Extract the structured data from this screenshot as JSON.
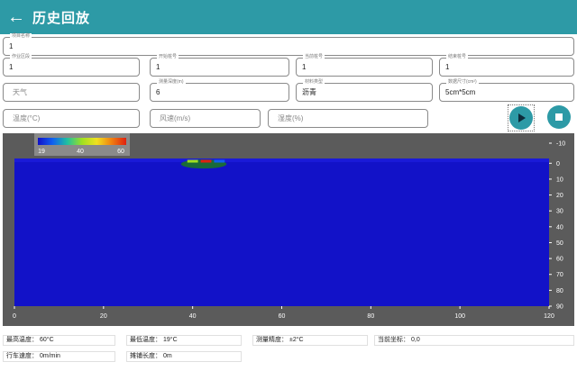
{
  "header": {
    "back_icon": "arrow-left-icon",
    "title": "历史回放"
  },
  "form": {
    "project": {
      "label": "项目名称",
      "value": "1"
    },
    "section": {
      "label": "作业区段",
      "value": "1"
    },
    "start_pile": {
      "label": "开始桩号",
      "value": "1"
    },
    "current_pile": {
      "label": "当前桩号",
      "value": "1"
    },
    "end_pile": {
      "label": "结束桩号",
      "value": "1"
    },
    "weather": {
      "placeholder": "天气"
    },
    "depth": {
      "label": "测量深度(m)",
      "value": "6"
    },
    "material": {
      "label": "材料类型",
      "value": "沥青"
    },
    "data_size": {
      "label": "数据尺寸(cm²)",
      "value": "5cm*5cm"
    },
    "temperature": {
      "placeholder": "温度(°C)"
    },
    "wind": {
      "placeholder": "风速(m/s)"
    },
    "humidity": {
      "placeholder": "湿度(%)"
    }
  },
  "controls": {
    "play_icon": "play-icon",
    "stop_icon": "stop-icon",
    "accent": "#2d9aa6"
  },
  "chart_data": {
    "type": "heatmap",
    "x_ticks": [
      "0",
      "20",
      "40",
      "60",
      "80",
      "100",
      "120"
    ],
    "y_ticks": [
      "-10",
      "0",
      "10",
      "20",
      "30",
      "40",
      "50",
      "60",
      "70",
      "80",
      "90"
    ],
    "xlim": [
      0,
      120
    ],
    "ylim": [
      -10,
      90
    ],
    "colorbar": {
      "ticks": [
        "19",
        "40",
        "60"
      ],
      "min": 19,
      "max": 60,
      "colors": [
        "#1010c8",
        "#1060f0",
        "#20c0a0",
        "#a0e020",
        "#f0e020",
        "#f08010",
        "#e02010"
      ]
    },
    "background_value": 19,
    "hotspot": {
      "x": [
        38,
        47
      ],
      "y": [
        -1,
        2
      ],
      "values": [
        40,
        60,
        28
      ]
    }
  },
  "stats": {
    "max_temp": {
      "label": "最高温度：",
      "value": "60°C"
    },
    "min_temp": {
      "label": "最低温度：",
      "value": "19°C"
    },
    "accuracy": {
      "label": "测量精度：",
      "value": "±2°C"
    },
    "coord": {
      "label": "当前坐标：",
      "value": "0,0"
    },
    "speed": {
      "label": "行车速度：",
      "value": "0m/min"
    },
    "length": {
      "label": "摊铺长度：",
      "value": "0m"
    }
  }
}
